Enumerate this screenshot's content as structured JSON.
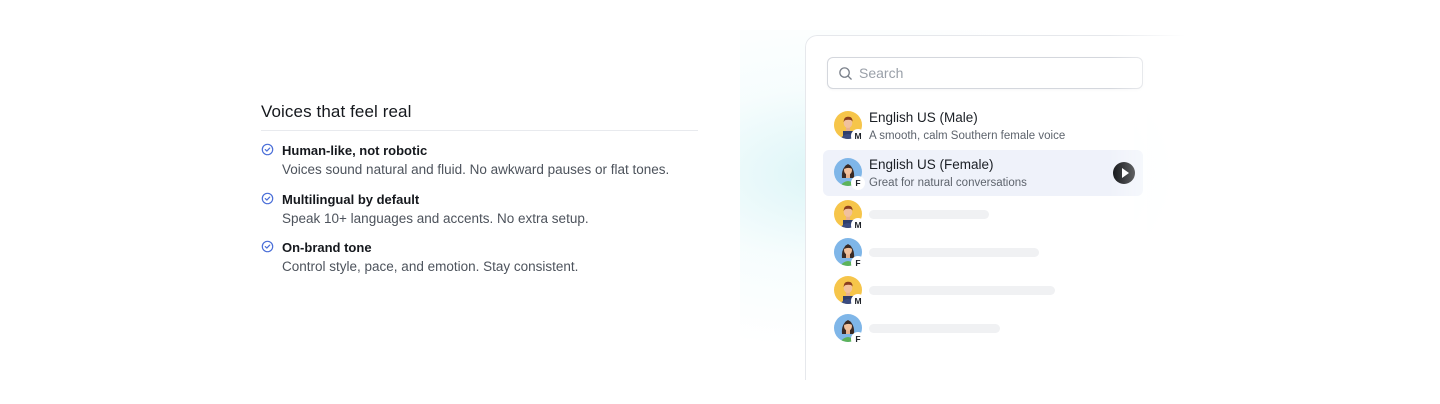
{
  "features": {
    "title": "Voices that feel real",
    "items": [
      {
        "title": "Human-like, not robotic",
        "description": "Voices sound natural and fluid. No awkward pauses or flat tones."
      },
      {
        "title": "Multilingual by default",
        "description": "Speak 10+ languages and accents. No extra setup."
      },
      {
        "title": "On-brand tone",
        "description": "Control style, pace, and emotion. Stay consistent."
      }
    ]
  },
  "picker": {
    "search": {
      "placeholder": "Search",
      "value": ""
    },
    "voices": [
      {
        "name": "English US (Male)",
        "description": "A smooth, calm Southern female voice",
        "gender_badge": "M",
        "selected": false
      },
      {
        "name": "English US (Female)",
        "description": "Great for natural conversations",
        "gender_badge": "F",
        "selected": true
      },
      {
        "gender_badge": "M",
        "loading": true
      },
      {
        "gender_badge": "F",
        "loading": true
      },
      {
        "gender_badge": "M",
        "loading": true
      },
      {
        "gender_badge": "F",
        "loading": true
      }
    ]
  },
  "colors": {
    "accent_check": "#4b6fd8",
    "selected_row_bg": "#eff2fa",
    "play_button": "#0d0f12",
    "male_avatar_bg": "#f6c54a",
    "female_avatar_bg": "#7fb6e8"
  },
  "icons": {
    "feature_check": "circle-check-icon",
    "search": "search-icon",
    "play": "play-icon"
  }
}
